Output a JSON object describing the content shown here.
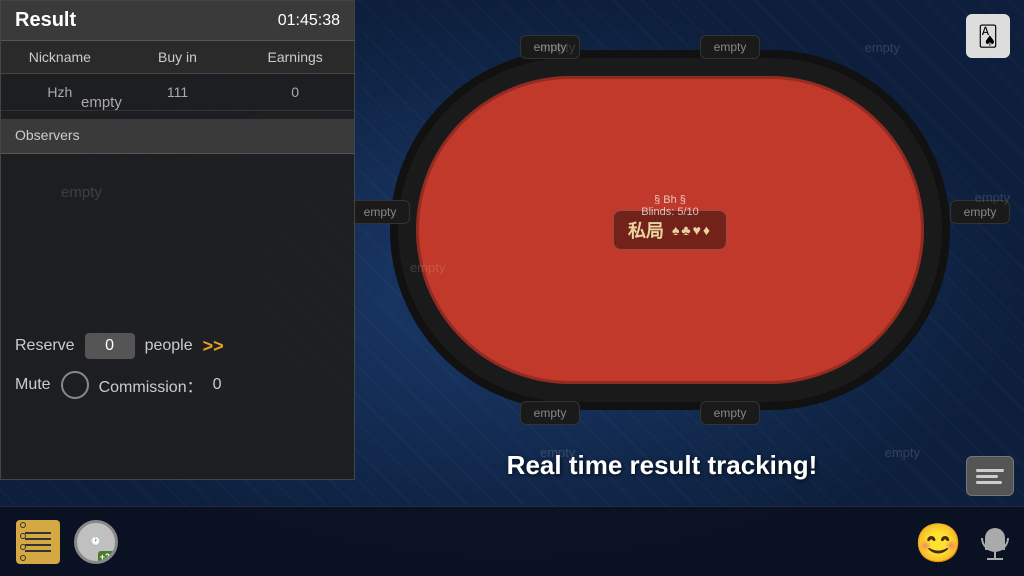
{
  "result_panel": {
    "title": "Result",
    "timer": "01:45:38",
    "table_headers": [
      "Nickname",
      "Buy in",
      "Earnings"
    ],
    "players": [
      {
        "nickname": "Hzh",
        "buy_in": "111",
        "earnings": "0"
      }
    ],
    "empty_label": "empty",
    "observers_label": "Observers"
  },
  "reserve": {
    "label": "Reserve",
    "value": "0",
    "people_label": "people",
    "arrow": ">>"
  },
  "mute": {
    "label": "Mute",
    "commission_label": "Commission：",
    "commission_value": "0"
  },
  "table": {
    "seats": [
      "empty",
      "empty",
      "empty",
      "empty",
      "empty",
      "empty",
      "empty",
      "empty"
    ],
    "game_name": "§ Bh §",
    "blinds": "Blinds: 5/10",
    "logo_text": "私局",
    "logo_suits": "♠♣♥♦"
  },
  "tagline": "Real time result tracking!",
  "card_icon": "🂡",
  "chat_icon": "≡",
  "emoji": "😊",
  "mic_label": "microphone",
  "notepad_label": "notepad",
  "clock_label": "clock",
  "clock_badge": "+20"
}
